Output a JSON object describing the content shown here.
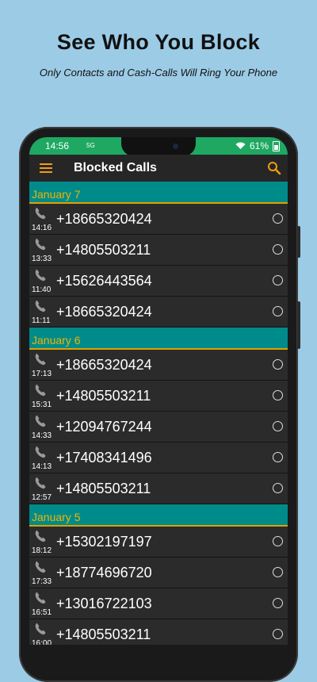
{
  "headline": "See Who You Block",
  "subline": "Only Contacts and Cash-Calls Will Ring Your Phone",
  "status": {
    "time": "14:56",
    "network": "5G",
    "battery": "61%"
  },
  "toolbar": {
    "title": "Blocked Calls"
  },
  "colors": {
    "background": "#9ccbe6",
    "status_bar": "#1fa862",
    "section": "#008b8b",
    "accent": "#f39c12"
  },
  "groups": [
    {
      "date": "January 7",
      "calls": [
        {
          "time": "14:16",
          "number": "+18665320424"
        },
        {
          "time": "13:33",
          "number": "+14805503211"
        },
        {
          "time": "11:40",
          "number": "+15626443564"
        },
        {
          "time": "11:11",
          "number": "+18665320424"
        }
      ]
    },
    {
      "date": "January 6",
      "calls": [
        {
          "time": "17:13",
          "number": "+18665320424"
        },
        {
          "time": "15:31",
          "number": "+14805503211"
        },
        {
          "time": "14:33",
          "number": "+12094767244"
        },
        {
          "time": "14:13",
          "number": "+17408341496"
        },
        {
          "time": "12:57",
          "number": "+14805503211"
        }
      ]
    },
    {
      "date": "January 5",
      "calls": [
        {
          "time": "18:12",
          "number": "+15302197197"
        },
        {
          "time": "17:33",
          "number": "+18774696720"
        },
        {
          "time": "16:51",
          "number": "+13016722103"
        },
        {
          "time": "16:00",
          "number": "+14805503211"
        }
      ]
    }
  ]
}
